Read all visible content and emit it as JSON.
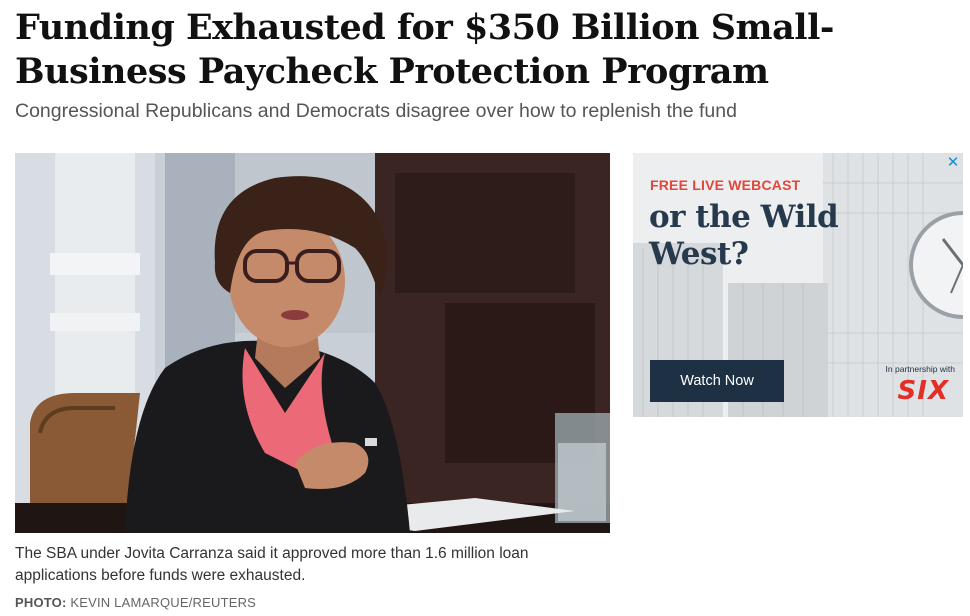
{
  "article": {
    "headline": "Funding Exhausted for $350 Billion Small-Business Paycheck Protection Program",
    "dek": "Congressional Republicans and Democrats disagree over how to replenish the fund",
    "image": {
      "caption": "The SBA under Jovita Carranza said it approved more than 1.6 million loan applications before funds were exhausted.",
      "credit_label": "PHOTO:",
      "credit_name": "KEVIN LAMARQUE/REUTERS"
    }
  },
  "ad": {
    "close_icon": "close-icon",
    "kicker": "FREE LIVE WEBCAST",
    "headline": "or the Wild West?",
    "cta_label": "Watch Now",
    "partner_text": "In partnership with",
    "partner_logo": "SIX",
    "colors": {
      "kicker": "#e4473a",
      "headline": "#27394d",
      "cta_bg": "#1d3044",
      "logo": "#e52d27"
    }
  }
}
